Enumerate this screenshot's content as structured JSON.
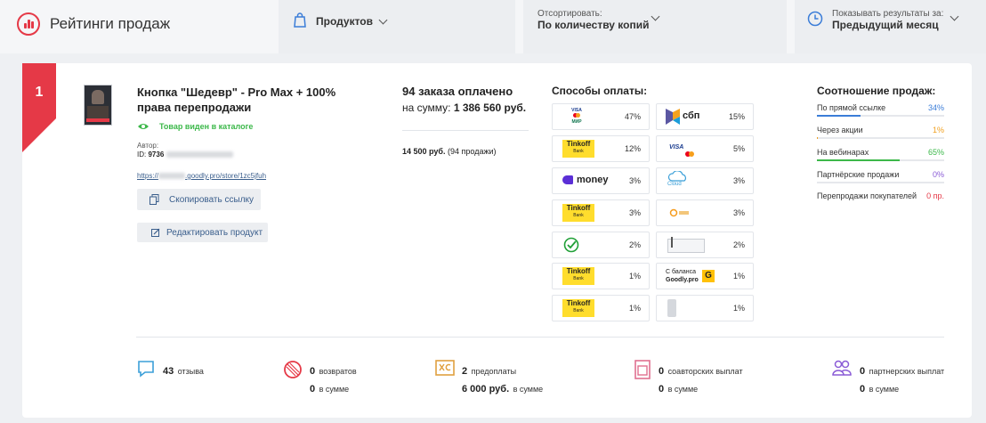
{
  "header": {
    "title": "Рейтинги продаж",
    "products_label": "Продуктов",
    "sort_caption": "Отсортировать:",
    "sort_value": "По количеству копий",
    "period_caption": "Показывать результаты за:",
    "period_value": "Предыдущий месяц"
  },
  "product": {
    "rank": "1",
    "name_line1": "Кнопка \"Шедевр\" - Pro Max + 100%",
    "name_line2": "права перепродажи",
    "visible_label": "Товар виден в каталоге",
    "author_label": "Автор:",
    "id_label": "ID:",
    "id_value": "9736",
    "link_prefix": "https://",
    "link_suffix": ".goodly.pro/store/1zc5jfuh",
    "copy_button": "Скопировать ссылку",
    "edit_button": "Редактировать продукт"
  },
  "orders": {
    "headline": "94 заказа оплачено",
    "sum_label": "на сумму:",
    "sum_value": "1 386 560 руб.",
    "price_value": "14 500 руб.",
    "price_note": "(94 продажи)"
  },
  "payments": {
    "title": "Способы оплаты:",
    "left": [
      {
        "method": "visa-mastercard-mir",
        "pct": "47%"
      },
      {
        "method": "tinkoff-bank",
        "pct": "12%"
      },
      {
        "method": "yoomoney",
        "pct": "3%"
      },
      {
        "method": "tinkoff-bank",
        "pct": "3%"
      },
      {
        "method": "sberbank",
        "pct": "2%"
      },
      {
        "method": "tinkoff-bank",
        "pct": "1%"
      },
      {
        "method": "tinkoff-bank",
        "pct": "1%"
      }
    ],
    "right": [
      {
        "method": "sbp",
        "pct": "15%"
      },
      {
        "method": "visa-mastercard",
        "pct": "5%"
      },
      {
        "method": "cloudpayments",
        "pct": "3%"
      },
      {
        "method": "qiwi",
        "pct": "3%"
      },
      {
        "method": "card-terminal",
        "pct": "2%"
      },
      {
        "method": "goodly-balance",
        "pct": "1%"
      },
      {
        "method": "phone-payment",
        "pct": "1%"
      }
    ],
    "logo_text": {
      "tinkoff": "Tinkoff",
      "tinkoff_sub": "Bank",
      "visa": "VISA",
      "mir": "МИР",
      "money": "money",
      "sbp": "сбп",
      "cloud": "Cloud",
      "balance_line1": "С баланса",
      "balance_line2": "Goodly.pro",
      "balance_badge": "G"
    }
  },
  "ratio": {
    "title": "Соотношение продаж:",
    "rows": [
      {
        "label": "По прямой ссылке",
        "value": "34%",
        "fraction": 0.34,
        "color": "#3b7dd8"
      },
      {
        "label": "Через акции",
        "value": "1%",
        "fraction": 0.01,
        "color": "#f0a020"
      },
      {
        "label": "На вебинарах",
        "value": "65%",
        "fraction": 0.65,
        "color": "#3cb84a"
      },
      {
        "label": "Партнёрские продажи",
        "value": "0%",
        "fraction": 0,
        "color": "#8a5bd6"
      },
      {
        "label": "Перепродажи покупателей",
        "value": "0 пр.",
        "fraction": 0,
        "color": "#e53947"
      }
    ]
  },
  "stats": {
    "reviews_count": "43",
    "reviews_label": "отзыва",
    "returns_count": "0",
    "returns_label": "возвратов",
    "returns_sum": "0",
    "returns_sum_label": "в сумме",
    "prepay_count": "2",
    "prepay_label": "предоплаты",
    "prepay_sum": "6 000 руб.",
    "prepay_sum_label": "в сумме",
    "coauthor_count": "0",
    "coauthor_label": "соавторских выплат",
    "coauthor_sum": "0",
    "coauthor_sum_label": "в сумме",
    "partner_count": "0",
    "partner_label": "партнерских выплат",
    "partner_sum": "0",
    "partner_sum_label": "в сумме"
  },
  "colors": {
    "accent": "#e53947",
    "green": "#3cb84a",
    "link": "#3a5e8c"
  }
}
